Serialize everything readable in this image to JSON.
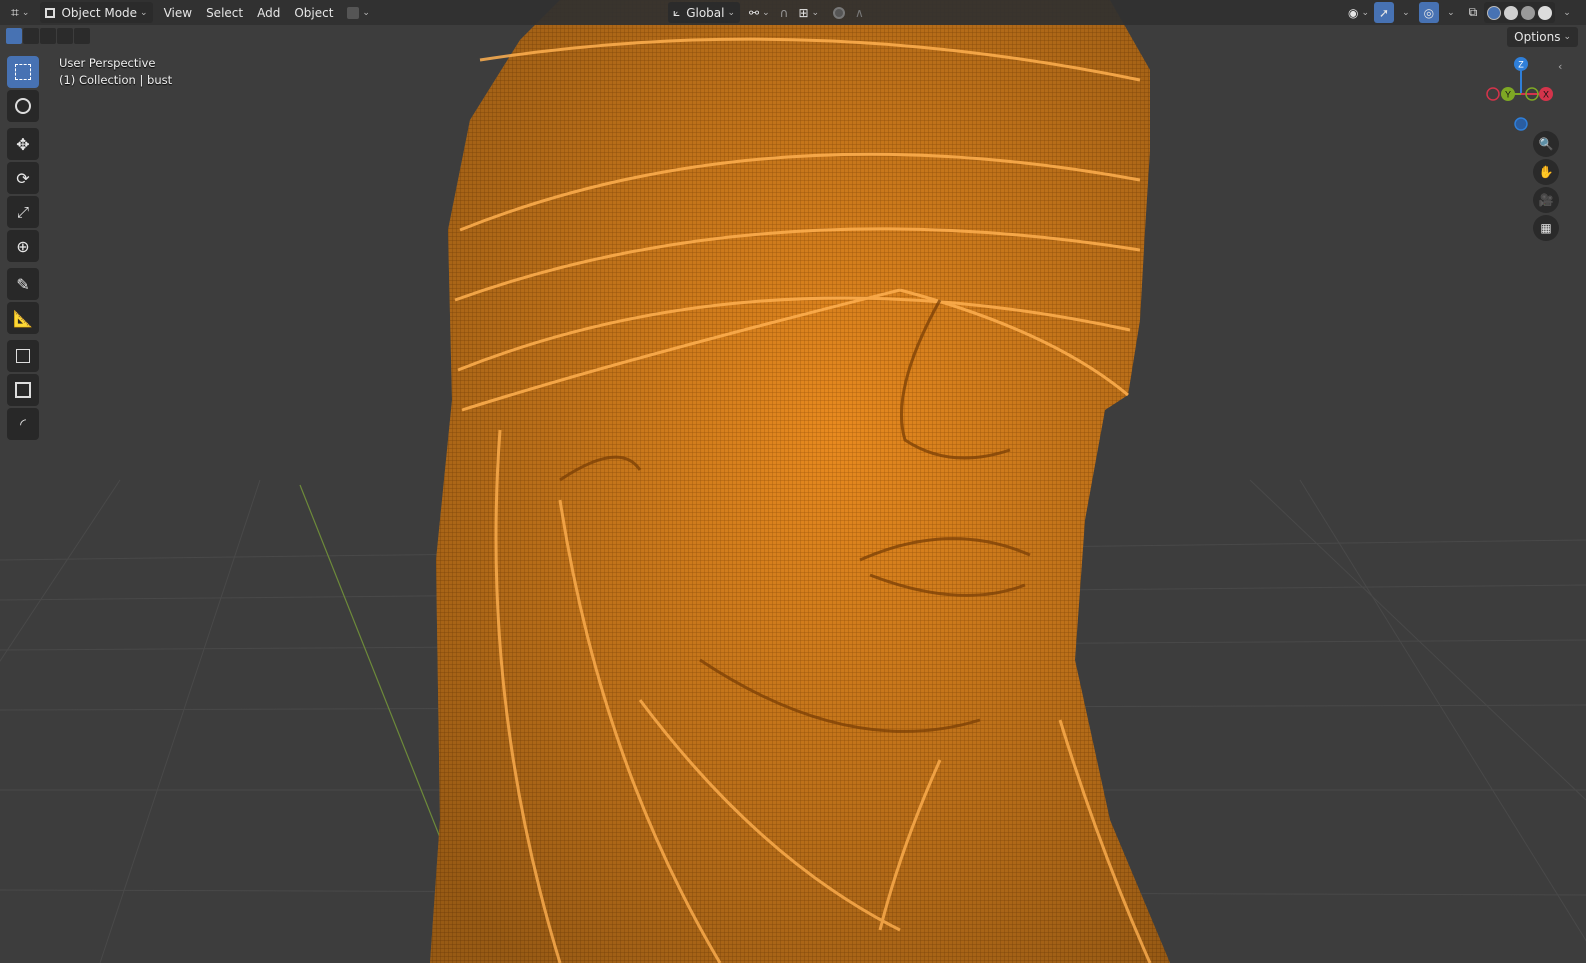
{
  "header": {
    "editor_type_icon": "3d-viewport-icon",
    "mode_label": "Object Mode",
    "mode_icon": "object-mode-icon",
    "menus": [
      "View",
      "Select",
      "Add",
      "Object"
    ],
    "transform_orientation": "Global",
    "pivot_icon": "pivot-link-icon",
    "snap_icon": "magnet-icon",
    "snap_target_icon": "snap-increment-icon",
    "proportional_icon": "proportional-edit-icon",
    "falloff_icon": "falloff-curve-icon",
    "visibility_icon": "eye-icon",
    "gizmo_icon": "gizmo-arrow-icon",
    "overlay_icon": "overlay-circles-icon",
    "xray_icon": "xray-icon",
    "shading_modes": [
      "wireframe",
      "solid",
      "material-preview",
      "rendered"
    ],
    "active_shading": "wireframe"
  },
  "options_label": "Options",
  "viewport": {
    "perspective_label": "User Perspective",
    "collection_label": "(1) Collection | bust",
    "mesh_color": "#f39a2a",
    "background_color": "#3d3d3d",
    "grid_color": "#494949",
    "y_axis_color": "#6d8a3a"
  },
  "toolbar": {
    "tools": [
      {
        "name": "select-box-tool",
        "icon": "select-box-icon",
        "active": true
      },
      {
        "name": "cursor-tool",
        "icon": "cursor-icon",
        "active": false
      },
      {
        "name": "move-tool",
        "icon": "move-icon",
        "active": false
      },
      {
        "name": "rotate-tool",
        "icon": "rotate-icon",
        "active": false
      },
      {
        "name": "scale-tool",
        "icon": "scale-icon",
        "active": false
      },
      {
        "name": "transform-tool",
        "icon": "transform-icon",
        "active": false
      },
      {
        "name": "annotate-tool",
        "icon": "annotate-icon",
        "active": false
      },
      {
        "name": "measure-tool",
        "icon": "measure-icon",
        "active": false
      },
      {
        "name": "add-cube-tool",
        "icon": "add-cube-icon",
        "active": false
      },
      {
        "name": "tool-extra-1",
        "icon": "square-frame-icon",
        "active": false
      },
      {
        "name": "tool-extra-2",
        "icon": "curve-corner-icon",
        "active": false
      }
    ]
  },
  "gizmo": {
    "axes": [
      {
        "label": "Z",
        "color": "#2f7fd9"
      },
      {
        "label": "Y",
        "color": "#7ea824"
      },
      {
        "label": "X",
        "color": "#d4344b"
      }
    ]
  },
  "nav_buttons": [
    "zoom-icon",
    "hand-pan-icon",
    "camera-icon",
    "grid-perspective-icon"
  ]
}
